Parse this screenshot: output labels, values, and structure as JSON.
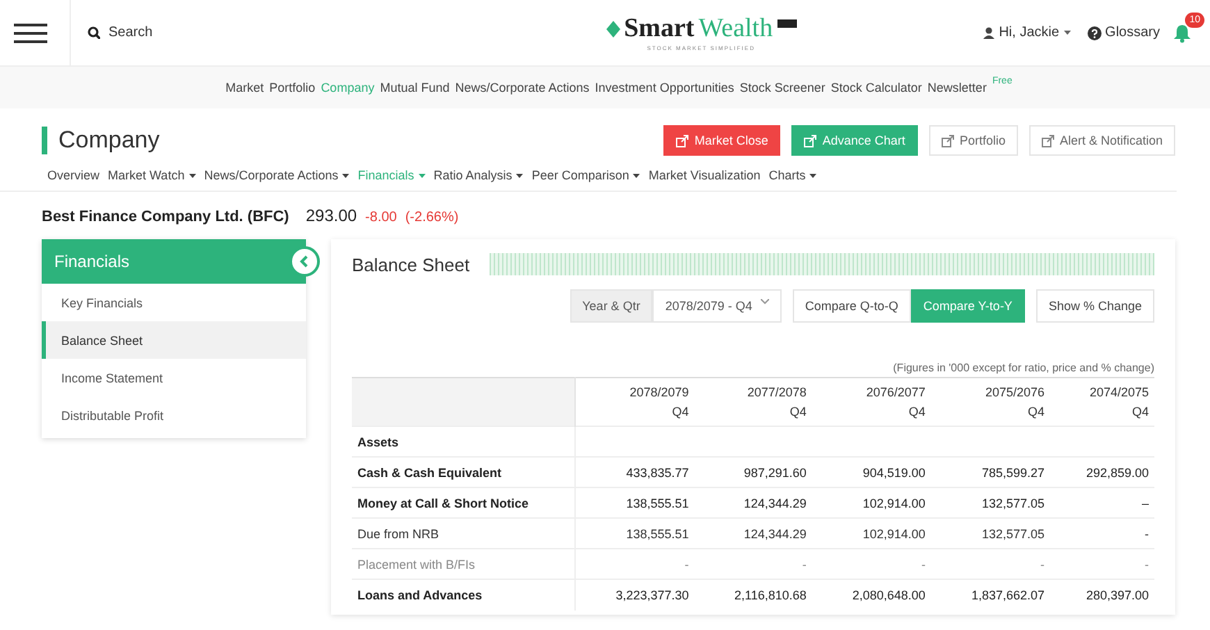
{
  "header": {
    "search": {
      "placeholder": "Search"
    },
    "logo": {
      "first": "Smart",
      "second": "Wealth",
      "tagline": "STOCK MARKET SIMPLIFIED"
    },
    "user": "Hi, Jackie",
    "glossary": "Glossary",
    "notifications": "10"
  },
  "main_nav": [
    {
      "label": "Market",
      "selected": false
    },
    {
      "label": "Portfolio",
      "selected": false
    },
    {
      "label": "Company",
      "selected": true
    },
    {
      "label": "Mutual Fund",
      "selected": false
    },
    {
      "label": "News/Corporate Actions",
      "selected": false
    },
    {
      "label": "Investment Opportunities",
      "selected": false
    },
    {
      "label": "Stock Screener",
      "selected": false
    },
    {
      "label": "Stock Calculator",
      "selected": false
    },
    {
      "label": "Newsletter",
      "selected": false,
      "badge": "Free"
    }
  ],
  "page_title": "Company",
  "actions": [
    {
      "label": "Market Close",
      "kind": "danger"
    },
    {
      "label": "Advance Chart",
      "kind": "success"
    },
    {
      "label": "Portfolio",
      "kind": "plain"
    },
    {
      "label": "Alert & Notification",
      "kind": "plain"
    }
  ],
  "sub_tabs": [
    {
      "label": "Overview",
      "dropdown": false,
      "selected": false
    },
    {
      "label": "Market Watch",
      "dropdown": true,
      "selected": false
    },
    {
      "label": "News/Corporate Actions",
      "dropdown": true,
      "selected": false
    },
    {
      "label": "Financials",
      "dropdown": true,
      "selected": true
    },
    {
      "label": "Ratio Analysis",
      "dropdown": true,
      "selected": false
    },
    {
      "label": "Peer Comparison",
      "dropdown": true,
      "selected": false
    },
    {
      "label": "Market Visualization",
      "dropdown": false,
      "selected": false
    },
    {
      "label": "Charts",
      "dropdown": true,
      "selected": false
    }
  ],
  "stock": {
    "name": "Best Finance Company Ltd. (BFC)",
    "price": "293.00",
    "change": "-8.00",
    "percent": "(-2.66%)"
  },
  "sidebar": {
    "title": "Financials",
    "items": [
      {
        "label": "Key Financials",
        "selected": false
      },
      {
        "label": "Balance Sheet",
        "selected": true
      },
      {
        "label": "Income Statement",
        "selected": false
      },
      {
        "label": "Distributable Profit",
        "selected": false
      }
    ]
  },
  "balance": {
    "title": "Balance Sheet",
    "period_label": "Year & Qtr",
    "period": "2078/2079 - Q4",
    "compare": [
      {
        "label": "Compare Q-to-Q",
        "selected": false
      },
      {
        "label": "Compare Y-to-Y",
        "selected": true
      }
    ],
    "show_change": "Show % Change",
    "note": "(Figures in '000 except for ratio, price and % change)",
    "columns": [
      {
        "year": "2078/2079",
        "quarter": "Q4"
      },
      {
        "year": "2077/2078",
        "quarter": "Q4"
      },
      {
        "year": "2076/2077",
        "quarter": "Q4"
      },
      {
        "year": "2075/2076",
        "quarter": "Q4"
      },
      {
        "year": "2074/2075",
        "quarter": "Q4"
      }
    ],
    "rows": [
      {
        "label": "Assets",
        "kind": "section",
        "values": []
      },
      {
        "label": "Cash & Cash Equivalent",
        "kind": "strong",
        "values": [
          "433,835.77",
          "987,291.60",
          "904,519.00",
          "785,599.27",
          "292,859.00"
        ]
      },
      {
        "label": "Money at Call & Short Notice",
        "kind": "strong",
        "values": [
          "138,555.51",
          "124,344.29",
          "102,914.00",
          "132,577.05",
          "–"
        ]
      },
      {
        "label": "Due from NRB",
        "kind": "normal",
        "values": [
          "138,555.51",
          "124,344.29",
          "102,914.00",
          "132,577.05",
          "-"
        ]
      },
      {
        "label": "Placement with B/FIs",
        "kind": "muted",
        "values": [
          "-",
          "-",
          "-",
          "-",
          "-"
        ]
      },
      {
        "label": "Loans and Advances",
        "kind": "strong",
        "values": [
          "3,223,377.30",
          "2,116,810.68",
          "2,080,648.00",
          "1,837,662.07",
          "280,397.00"
        ]
      }
    ]
  }
}
